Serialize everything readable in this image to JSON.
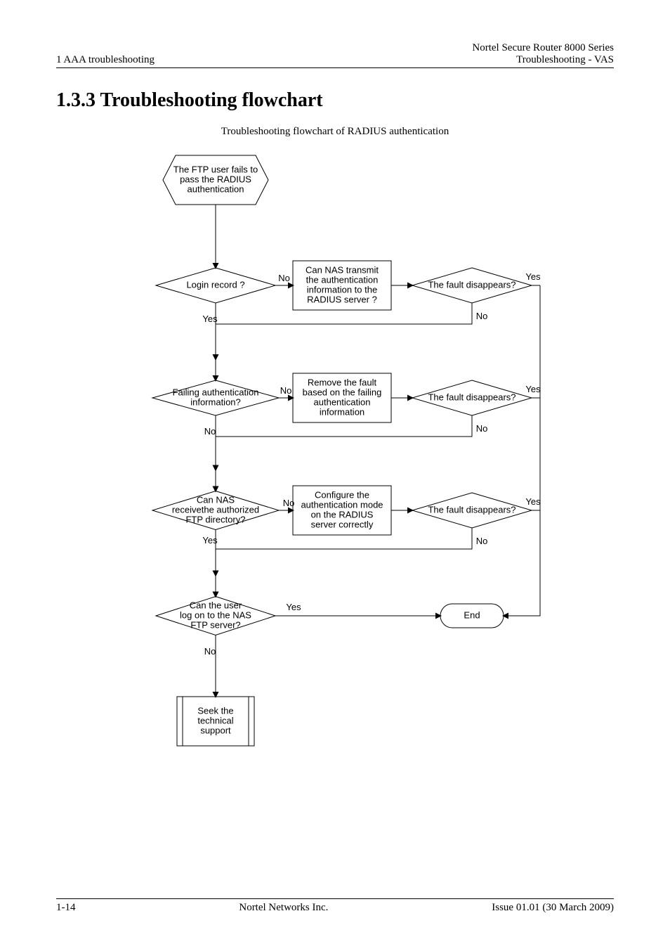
{
  "header": {
    "left": "1 AAA troubleshooting",
    "right_line1": "Nortel Secure Router 8000 Series",
    "right_line2": "Troubleshooting - VAS"
  },
  "section": {
    "number_title": "1.3.3 Troubleshooting flowchart",
    "figure_caption": "Troubleshooting flowchart of RADIUS authentication"
  },
  "footer": {
    "left": "1-14",
    "center": "Nortel Networks Inc.",
    "right": "Issue 01.01  (30 March 2009)"
  },
  "chart_data": {
    "type": "flowchart",
    "nodes": [
      {
        "id": "start",
        "shape": "hexagon",
        "text_lines": [
          "The FTP user fails to",
          "pass the RADIUS",
          "authentication"
        ]
      },
      {
        "id": "d1",
        "shape": "diamond",
        "text_lines": [
          "Login record ?"
        ]
      },
      {
        "id": "p1",
        "shape": "rect",
        "text_lines": [
          "Can NAS transmit",
          "the authentication",
          "information to the",
          "RADIUS server ?"
        ]
      },
      {
        "id": "f1",
        "shape": "diamond",
        "text_lines": [
          "The fault disappears?"
        ]
      },
      {
        "id": "d2",
        "shape": "diamond",
        "text_lines": [
          "Failing   authentication",
          "information?"
        ]
      },
      {
        "id": "p2",
        "shape": "rect",
        "text_lines": [
          "Remove the fault",
          "based on the failing",
          "authentication",
          "information"
        ]
      },
      {
        "id": "f2",
        "shape": "diamond",
        "text_lines": [
          "The fault disappears?"
        ]
      },
      {
        "id": "d3",
        "shape": "diamond",
        "text_lines": [
          "Can NAS",
          "receivethe authorized",
          "FTP directory?"
        ]
      },
      {
        "id": "p3",
        "shape": "rect",
        "text_lines": [
          "Configure the",
          "authentication mode",
          "on the RADIUS",
          "server correctly"
        ]
      },
      {
        "id": "f3",
        "shape": "diamond",
        "text_lines": [
          "The fault disappears?"
        ]
      },
      {
        "id": "d4",
        "shape": "diamond",
        "text_lines": [
          "Can the user",
          "log on to the NAS",
          "FTP server?"
        ]
      },
      {
        "id": "end",
        "shape": "terminator",
        "text_lines": [
          "End"
        ]
      },
      {
        "id": "seek",
        "shape": "predef",
        "text_lines": [
          "Seek the",
          "technical",
          "support"
        ]
      }
    ],
    "edges": [
      {
        "from": "start",
        "to": "d1",
        "label": ""
      },
      {
        "from": "d1",
        "to": "p1",
        "label": "No"
      },
      {
        "from": "p1",
        "to": "f1",
        "label": ""
      },
      {
        "from": "f1",
        "to": "end",
        "label": "Yes"
      },
      {
        "from": "f1",
        "to": "d2",
        "label": "No"
      },
      {
        "from": "d1",
        "to": "d2",
        "label": "Yes"
      },
      {
        "from": "d2",
        "to": "p2",
        "label": "No"
      },
      {
        "from": "p2",
        "to": "f2",
        "label": ""
      },
      {
        "from": "f2",
        "to": "end",
        "label": "Yes"
      },
      {
        "from": "f2",
        "to": "d3",
        "label": "No"
      },
      {
        "from": "d2",
        "to": "d3",
        "label": "No"
      },
      {
        "from": "d3",
        "to": "p3",
        "label": "No"
      },
      {
        "from": "p3",
        "to": "f3",
        "label": ""
      },
      {
        "from": "f3",
        "to": "end",
        "label": "Yes"
      },
      {
        "from": "f3",
        "to": "d4",
        "label": "No"
      },
      {
        "from": "d3",
        "to": "d4",
        "label": "Yes"
      },
      {
        "from": "d4",
        "to": "end",
        "label": "Yes"
      },
      {
        "from": "d4",
        "to": "seek",
        "label": "No"
      }
    ]
  }
}
